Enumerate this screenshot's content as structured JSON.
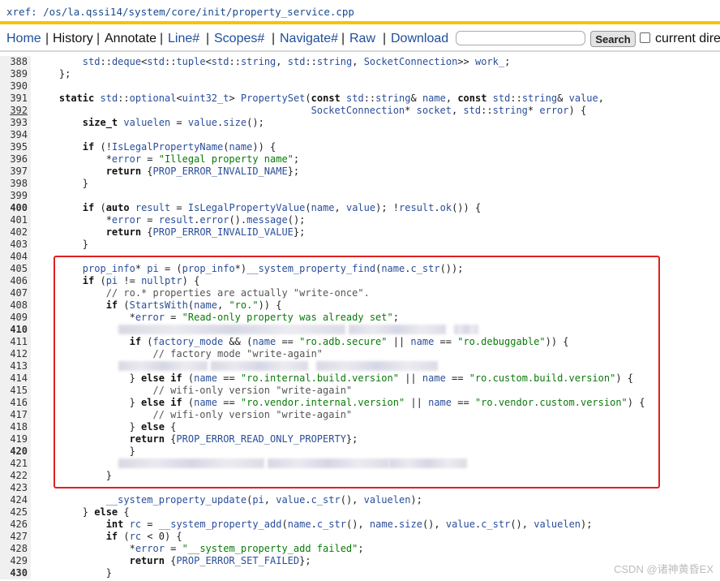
{
  "header": {
    "xref": "xref: /os/la.qssi14/system/core/init/property_service.cpp"
  },
  "nav": {
    "items": [
      "Home",
      "History",
      "Annotate",
      "Line#",
      "Scopes#",
      "Navigate#",
      "Raw",
      "Download"
    ],
    "search_value": "",
    "search_button": "Search",
    "checkbox_label": "current dire"
  },
  "code": [
    {
      "n": "388",
      "t": "        std::deque<std::tuple<std::string, std::string, SocketConnection>> work_;"
    },
    {
      "n": "389",
      "t": "    };"
    },
    {
      "n": "390",
      "t": ""
    },
    {
      "n": "391",
      "t": "    static std::optional<uint32_t> PropertySet(const std::string& name, const std::string& value,"
    },
    {
      "n": "392",
      "t": "                                               SocketConnection* socket, std::string* error) {"
    },
    {
      "n": "393",
      "t": "        size_t valuelen = value.size();"
    },
    {
      "n": "394",
      "t": ""
    },
    {
      "n": "395",
      "t": "        if (!IsLegalPropertyName(name)) {"
    },
    {
      "n": "396",
      "t": "            *error = \"Illegal property name\";"
    },
    {
      "n": "397",
      "t": "            return {PROP_ERROR_INVALID_NAME};"
    },
    {
      "n": "398",
      "t": "        }"
    },
    {
      "n": "399",
      "t": ""
    },
    {
      "n": "400",
      "t": "        if (auto result = IsLegalPropertyValue(name, value); !result.ok()) {"
    },
    {
      "n": "401",
      "t": "            *error = result.error().message();"
    },
    {
      "n": "402",
      "t": "            return {PROP_ERROR_INVALID_VALUE};"
    },
    {
      "n": "403",
      "t": "        }"
    },
    {
      "n": "404",
      "t": ""
    },
    {
      "n": "405",
      "t": "        prop_info* pi = (prop_info*)__system_property_find(name.c_str());"
    },
    {
      "n": "406",
      "t": "        if (pi != nullptr) {"
    },
    {
      "n": "407",
      "t": "            // ro.* properties are actually \"write-once\"."
    },
    {
      "n": "408",
      "t": "            if (StartsWith(name, \"ro.\")) {"
    },
    {
      "n": "409",
      "t": "                *error = \"Read-only property was already set\";"
    },
    {
      "n": "410",
      "t": ""
    },
    {
      "n": "411",
      "t": "                if (factory_mode && (name == \"ro.adb.secure\" || name == \"ro.debuggable\")) {"
    },
    {
      "n": "412",
      "t": "                    // factory mode \"write-again\""
    },
    {
      "n": "413",
      "t": ""
    },
    {
      "n": "414",
      "t": "                } else if (name == \"ro.internal.build.version\" || name == \"ro.custom.build.version\") {"
    },
    {
      "n": "415",
      "t": "                    // wifi-only version \"write-again\""
    },
    {
      "n": "416",
      "t": "                } else if (name == \"ro.vendor.internal.version\" || name == \"ro.vendor.custom.version\") {"
    },
    {
      "n": "417",
      "t": "                    // wifi-only version \"write-again\""
    },
    {
      "n": "418",
      "t": "                } else {"
    },
    {
      "n": "419",
      "t": "                return {PROP_ERROR_READ_ONLY_PROPERTY};"
    },
    {
      "n": "420",
      "t": "                }"
    },
    {
      "n": "421",
      "t": ""
    },
    {
      "n": "422",
      "t": "            }"
    },
    {
      "n": "423",
      "t": ""
    },
    {
      "n": "424",
      "t": "            __system_property_update(pi, value.c_str(), valuelen);"
    },
    {
      "n": "425",
      "t": "        } else {"
    },
    {
      "n": "426",
      "t": "            int rc = __system_property_add(name.c_str(), name.size(), value.c_str(), valuelen);"
    },
    {
      "n": "427",
      "t": "            if (rc < 0) {"
    },
    {
      "n": "428",
      "t": "                *error = \"__system_property_add failed\";"
    },
    {
      "n": "429",
      "t": "                return {PROP_ERROR_SET_FAILED};"
    },
    {
      "n": "430",
      "t": "            }"
    }
  ],
  "watermark": "CSDN @诸神黄昏EX"
}
